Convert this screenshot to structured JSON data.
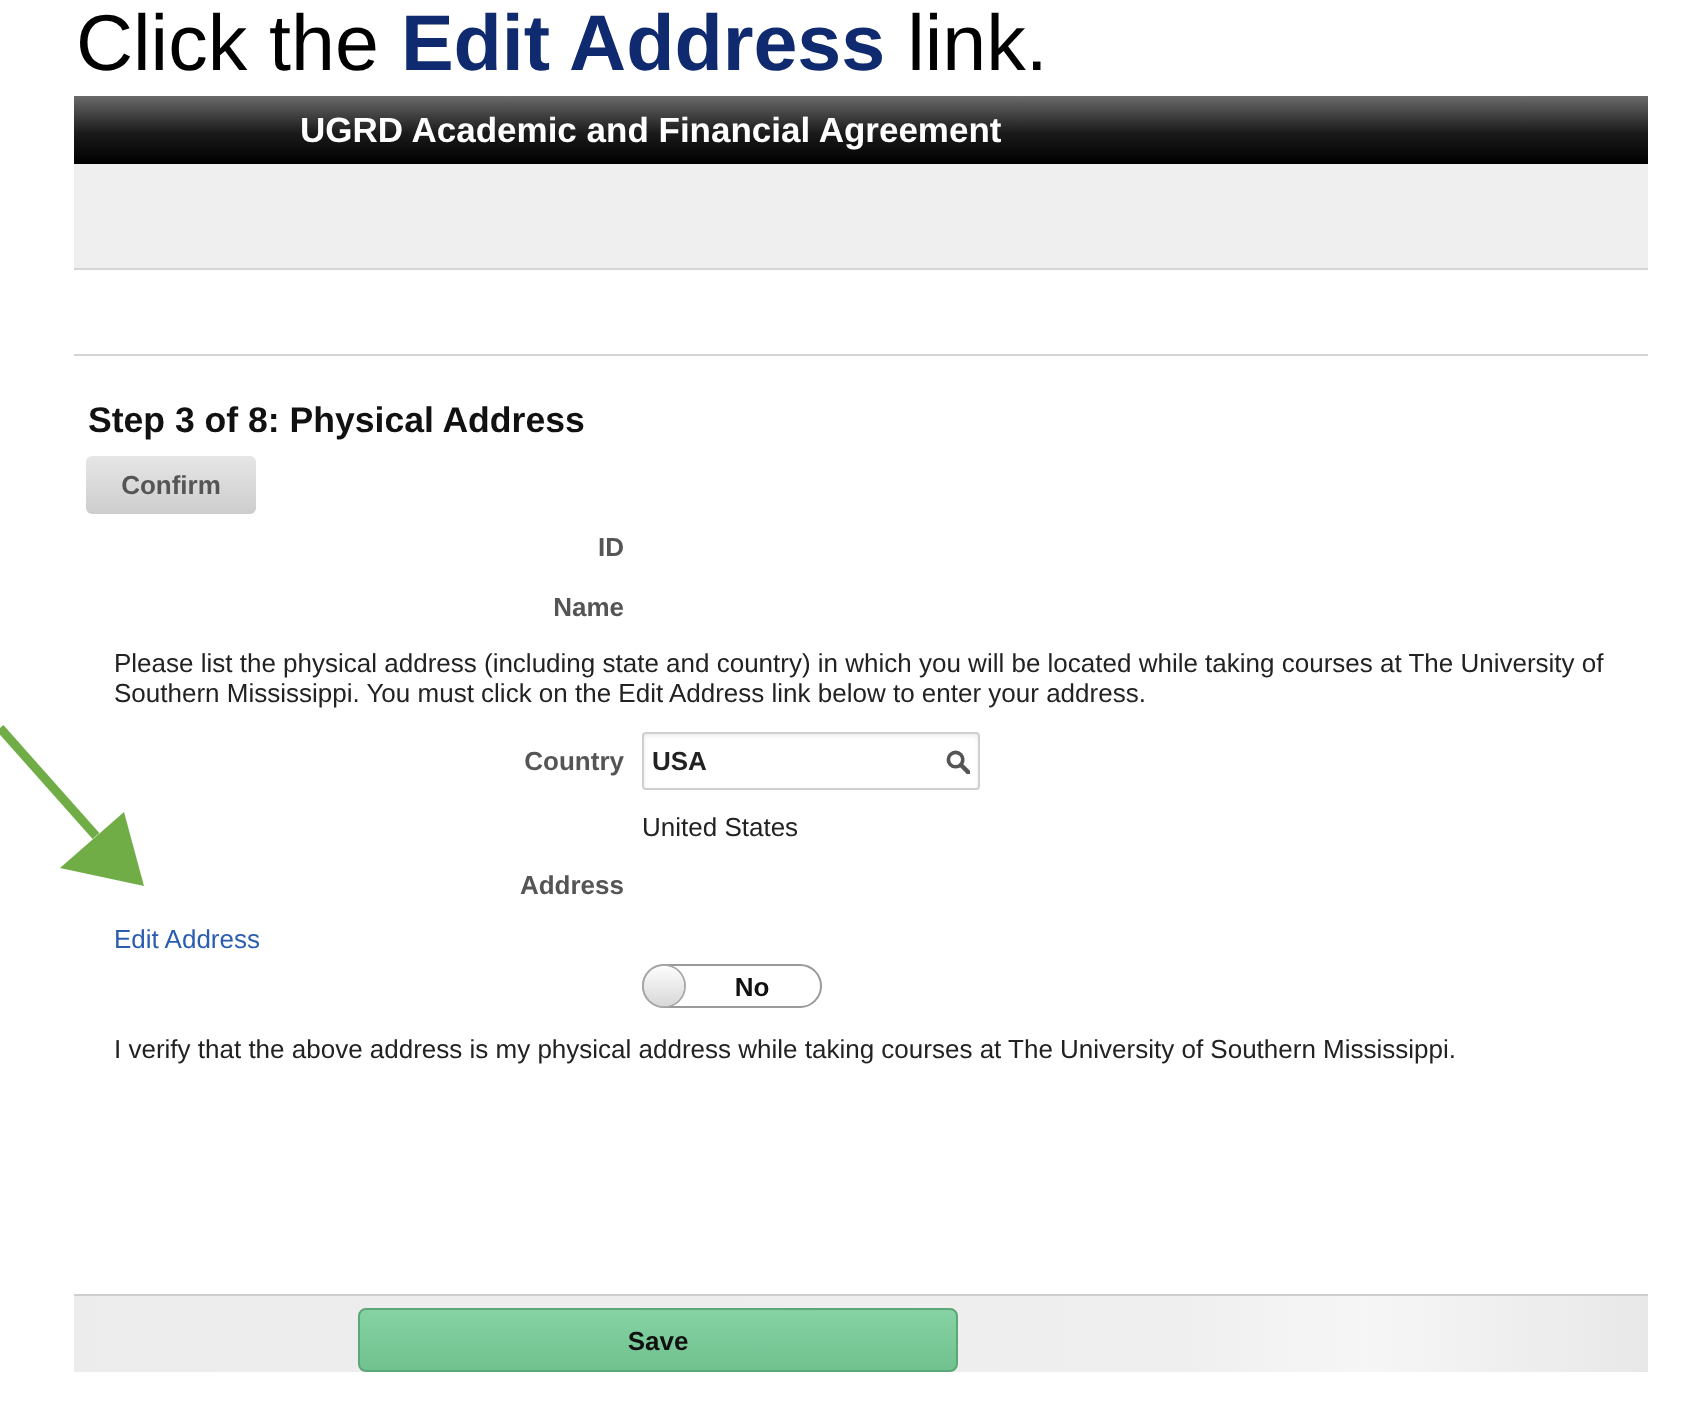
{
  "instruction": {
    "text": "Click the **Edit Address** link."
  },
  "window": {
    "title": "UGRD Academic and Financial Agreement"
  },
  "form": {
    "heading": "Step 3 of 8: Physical Address",
    "confirm_button": "Confirm",
    "rows": [
      {
        "kind": "label",
        "label": "ID"
      },
      {
        "kind": "label",
        "label": "Name"
      },
      {
        "kind": "paragraph",
        "text": "Please list the physical address (including state and country) in which you will be located while taking courses at The University of Southern Mississippi. You must click on the Edit Address link below to enter your address."
      },
      {
        "kind": "lookup",
        "label": "Country",
        "value": "USA",
        "description": "United States"
      },
      {
        "kind": "label",
        "label": "Address"
      },
      {
        "kind": "link",
        "text": "Edit Address"
      },
      {
        "kind": "toggle",
        "text": "No",
        "on": false
      },
      {
        "kind": "paragraph",
        "text": "I verify that the above address is my physical address while taking courses at The University of Southern Mississippi."
      }
    ]
  },
  "footer": {
    "save_button": "Save"
  }
}
